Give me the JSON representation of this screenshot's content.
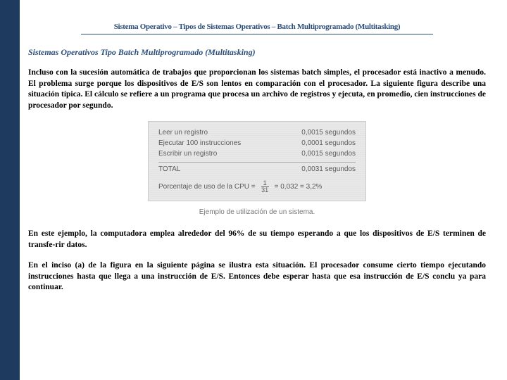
{
  "breadcrumb": "Sistema Operativo – Tipos de Sistemas Operativos – Batch Multiprogramado (Multitasking)",
  "subtitle": "Sistemas Operativos Tipo Batch Multiprogramado (Multitasking)",
  "paragraph1": "Incluso con la sucesión automática de trabajos que proporcionan los sistemas batch simples, el procesador está inactivo a menudo. El problema surge porque los dispositivos de E/S son lentos en comparación con el procesador. La siguiente figura describe una situación típica. El cálculo se refiere a un programa que procesa un archivo de registros y ejecuta, en promedio, cien instrucciones de procesador por segundo.",
  "figure": {
    "rows": [
      {
        "label": "Leer un registro",
        "value": "0,0015 segundos"
      },
      {
        "label": "Ejecutar 100 instrucciones",
        "value": "0,0001 segundos"
      },
      {
        "label": "Escribir un registro",
        "value": "0,0015 segundos"
      }
    ],
    "total_label": "TOTAL",
    "total_value": "0,0031 segundos",
    "pct_label": "Porcentaje de uso de la CPU =",
    "frac_num": "1",
    "frac_den": "31",
    "pct_rest": "= 0,032 = 3,2%",
    "caption": "Ejemplo de utilización de un sistema."
  },
  "paragraph2": "En este ejemplo, la computadora emplea alrededor del 96% de su tiempo esperando a que los dispositivos de E/S terminen de transfe-rir datos.",
  "paragraph3": "En el inciso (a) de la figura en la siguiente página se ilustra esta situación. El procesador consume cierto tiempo ejecutando instrucciones hasta que llega a una instrucción de E/S. Entonces debe esperar hasta que esa instrucción de E/S conclu ya para continuar."
}
